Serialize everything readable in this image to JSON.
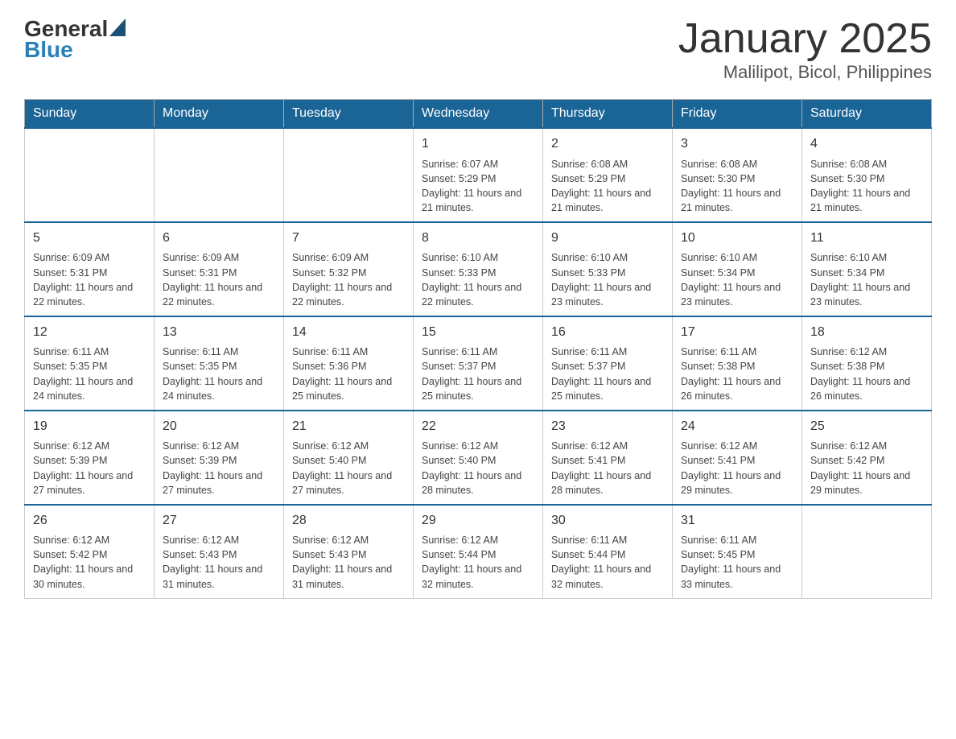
{
  "logo": {
    "text_general": "General",
    "text_blue": "Blue"
  },
  "title": "January 2025",
  "subtitle": "Malilipot, Bicol, Philippines",
  "days_of_week": [
    "Sunday",
    "Monday",
    "Tuesday",
    "Wednesday",
    "Thursday",
    "Friday",
    "Saturday"
  ],
  "weeks": [
    {
      "days": [
        {
          "number": "",
          "info": ""
        },
        {
          "number": "",
          "info": ""
        },
        {
          "number": "",
          "info": ""
        },
        {
          "number": "1",
          "info": "Sunrise: 6:07 AM\nSunset: 5:29 PM\nDaylight: 11 hours and 21 minutes."
        },
        {
          "number": "2",
          "info": "Sunrise: 6:08 AM\nSunset: 5:29 PM\nDaylight: 11 hours and 21 minutes."
        },
        {
          "number": "3",
          "info": "Sunrise: 6:08 AM\nSunset: 5:30 PM\nDaylight: 11 hours and 21 minutes."
        },
        {
          "number": "4",
          "info": "Sunrise: 6:08 AM\nSunset: 5:30 PM\nDaylight: 11 hours and 21 minutes."
        }
      ]
    },
    {
      "days": [
        {
          "number": "5",
          "info": "Sunrise: 6:09 AM\nSunset: 5:31 PM\nDaylight: 11 hours and 22 minutes."
        },
        {
          "number": "6",
          "info": "Sunrise: 6:09 AM\nSunset: 5:31 PM\nDaylight: 11 hours and 22 minutes."
        },
        {
          "number": "7",
          "info": "Sunrise: 6:09 AM\nSunset: 5:32 PM\nDaylight: 11 hours and 22 minutes."
        },
        {
          "number": "8",
          "info": "Sunrise: 6:10 AM\nSunset: 5:33 PM\nDaylight: 11 hours and 22 minutes."
        },
        {
          "number": "9",
          "info": "Sunrise: 6:10 AM\nSunset: 5:33 PM\nDaylight: 11 hours and 23 minutes."
        },
        {
          "number": "10",
          "info": "Sunrise: 6:10 AM\nSunset: 5:34 PM\nDaylight: 11 hours and 23 minutes."
        },
        {
          "number": "11",
          "info": "Sunrise: 6:10 AM\nSunset: 5:34 PM\nDaylight: 11 hours and 23 minutes."
        }
      ]
    },
    {
      "days": [
        {
          "number": "12",
          "info": "Sunrise: 6:11 AM\nSunset: 5:35 PM\nDaylight: 11 hours and 24 minutes."
        },
        {
          "number": "13",
          "info": "Sunrise: 6:11 AM\nSunset: 5:35 PM\nDaylight: 11 hours and 24 minutes."
        },
        {
          "number": "14",
          "info": "Sunrise: 6:11 AM\nSunset: 5:36 PM\nDaylight: 11 hours and 25 minutes."
        },
        {
          "number": "15",
          "info": "Sunrise: 6:11 AM\nSunset: 5:37 PM\nDaylight: 11 hours and 25 minutes."
        },
        {
          "number": "16",
          "info": "Sunrise: 6:11 AM\nSunset: 5:37 PM\nDaylight: 11 hours and 25 minutes."
        },
        {
          "number": "17",
          "info": "Sunrise: 6:11 AM\nSunset: 5:38 PM\nDaylight: 11 hours and 26 minutes."
        },
        {
          "number": "18",
          "info": "Sunrise: 6:12 AM\nSunset: 5:38 PM\nDaylight: 11 hours and 26 minutes."
        }
      ]
    },
    {
      "days": [
        {
          "number": "19",
          "info": "Sunrise: 6:12 AM\nSunset: 5:39 PM\nDaylight: 11 hours and 27 minutes."
        },
        {
          "number": "20",
          "info": "Sunrise: 6:12 AM\nSunset: 5:39 PM\nDaylight: 11 hours and 27 minutes."
        },
        {
          "number": "21",
          "info": "Sunrise: 6:12 AM\nSunset: 5:40 PM\nDaylight: 11 hours and 27 minutes."
        },
        {
          "number": "22",
          "info": "Sunrise: 6:12 AM\nSunset: 5:40 PM\nDaylight: 11 hours and 28 minutes."
        },
        {
          "number": "23",
          "info": "Sunrise: 6:12 AM\nSunset: 5:41 PM\nDaylight: 11 hours and 28 minutes."
        },
        {
          "number": "24",
          "info": "Sunrise: 6:12 AM\nSunset: 5:41 PM\nDaylight: 11 hours and 29 minutes."
        },
        {
          "number": "25",
          "info": "Sunrise: 6:12 AM\nSunset: 5:42 PM\nDaylight: 11 hours and 29 minutes."
        }
      ]
    },
    {
      "days": [
        {
          "number": "26",
          "info": "Sunrise: 6:12 AM\nSunset: 5:42 PM\nDaylight: 11 hours and 30 minutes."
        },
        {
          "number": "27",
          "info": "Sunrise: 6:12 AM\nSunset: 5:43 PM\nDaylight: 11 hours and 31 minutes."
        },
        {
          "number": "28",
          "info": "Sunrise: 6:12 AM\nSunset: 5:43 PM\nDaylight: 11 hours and 31 minutes."
        },
        {
          "number": "29",
          "info": "Sunrise: 6:12 AM\nSunset: 5:44 PM\nDaylight: 11 hours and 32 minutes."
        },
        {
          "number": "30",
          "info": "Sunrise: 6:11 AM\nSunset: 5:44 PM\nDaylight: 11 hours and 32 minutes."
        },
        {
          "number": "31",
          "info": "Sunrise: 6:11 AM\nSunset: 5:45 PM\nDaylight: 11 hours and 33 minutes."
        },
        {
          "number": "",
          "info": ""
        }
      ]
    }
  ]
}
